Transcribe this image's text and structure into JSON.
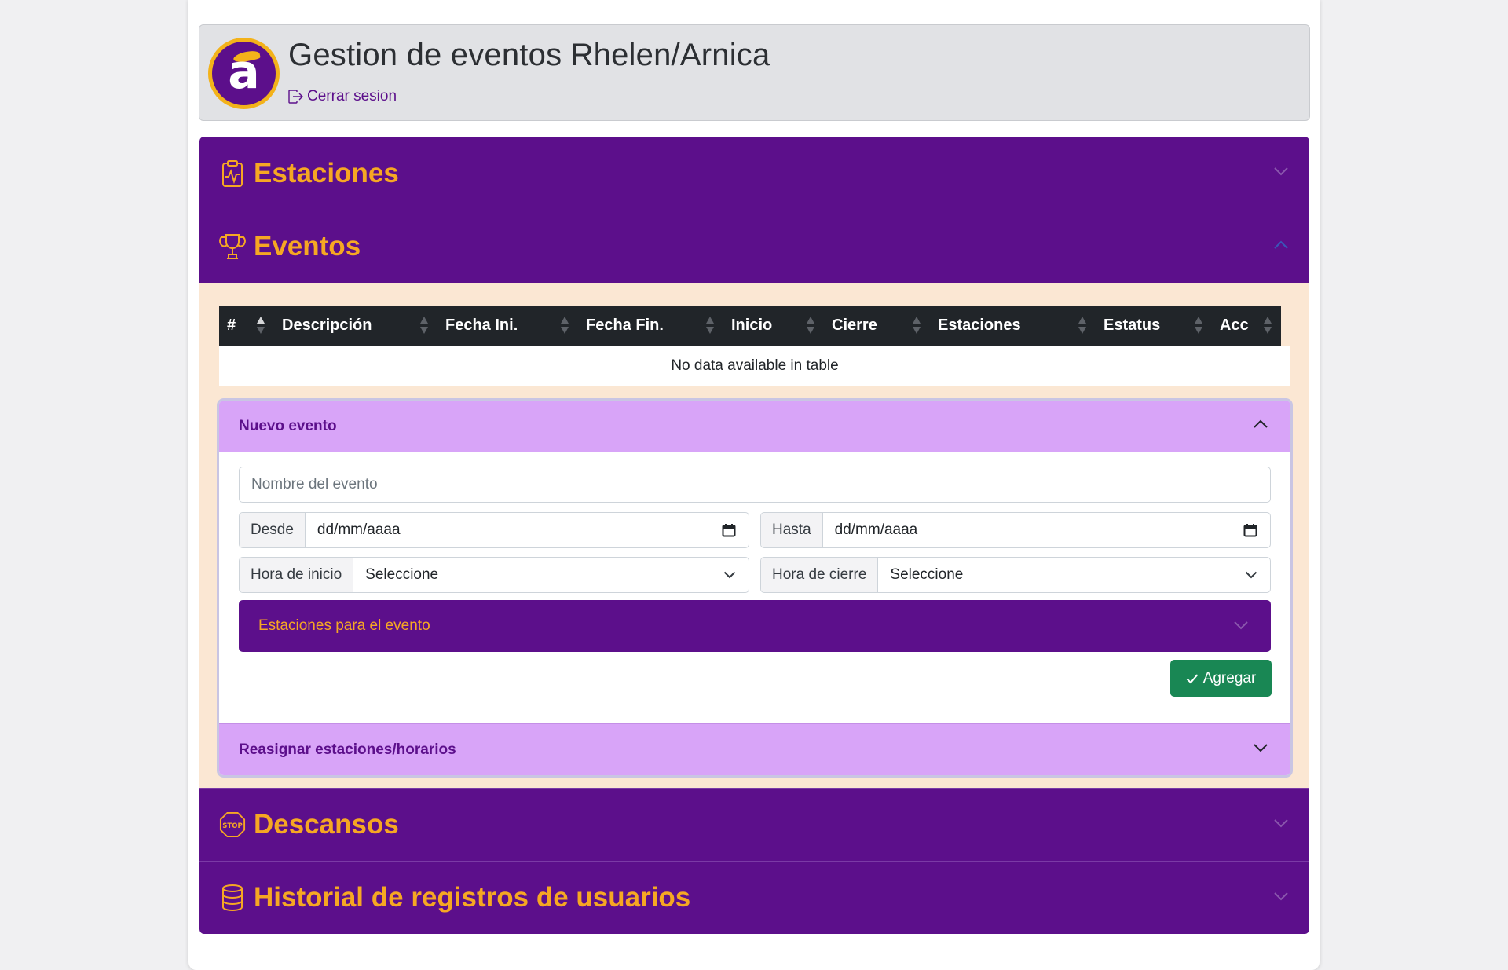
{
  "app": {
    "title": "Gestion de eventos Rhelen/Arnica",
    "logout_label": "Cerrar sesion",
    "logo_letter": "a"
  },
  "colors": {
    "brand_purple": "#5c0f8b",
    "accent_orange": "#f6a723",
    "panel_bg": "#fbe7d3",
    "sub_header": "#d8a4f8",
    "success": "#198754"
  },
  "sections": {
    "estaciones": {
      "label": "Estaciones",
      "icon": "clipboard-pulse-icon",
      "expanded": false
    },
    "eventos": {
      "label": "Eventos",
      "icon": "trophy-icon",
      "expanded": true
    },
    "descansos": {
      "label": "Descansos",
      "icon": "stop-sign-icon",
      "expanded": false
    },
    "historial": {
      "label": "Historial de registros de usuarios",
      "icon": "database-icon",
      "expanded": false
    }
  },
  "events_table": {
    "columns": [
      "#",
      "Descripción",
      "Fecha Ini.",
      "Fecha Fin.",
      "Inicio",
      "Cierre",
      "Estaciones",
      "Estatus",
      "Acc"
    ],
    "rows": [],
    "empty_message": "No data available in table"
  },
  "new_event": {
    "header": "Nuevo evento",
    "name_placeholder": "Nombre del evento",
    "from_label": "Desde",
    "from_value": "dd/mm/aaaa",
    "to_label": "Hasta",
    "to_value": "dd/mm/aaaa",
    "start_time_label": "Hora de inicio",
    "start_time_value": "Seleccione",
    "end_time_label": "Hora de cierre",
    "end_time_value": "Seleccione",
    "stations_label": "Estaciones para el evento",
    "add_button": "Agregar"
  },
  "reassign": {
    "header": "Reasignar estaciones/horarios"
  }
}
